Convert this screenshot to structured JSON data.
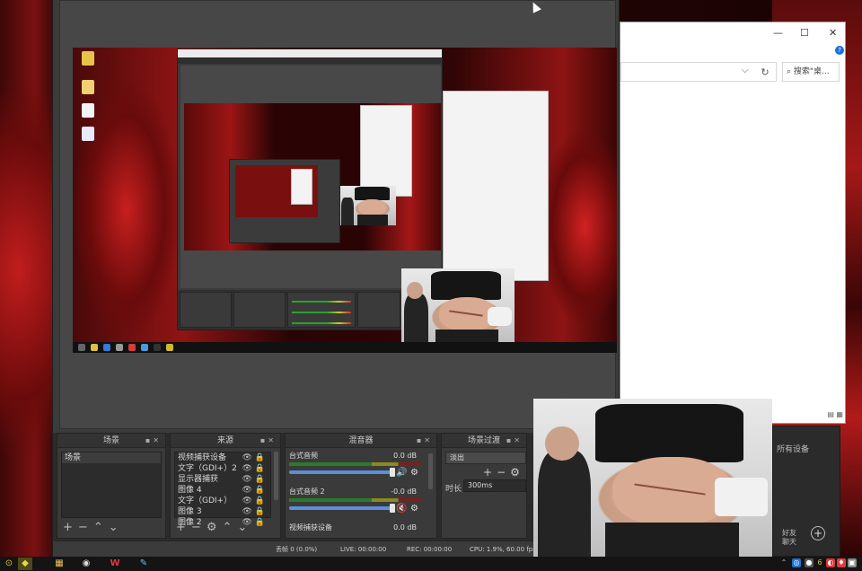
{
  "obs": {
    "docks": {
      "scenes": {
        "title": "场景",
        "items": [
          "场景"
        ]
      },
      "sources": {
        "title": "来源",
        "items": [
          "视频捕获设备",
          "文字（GDI+）2",
          "显示器捕获",
          "图像 4",
          "文字（GDI+）",
          "图像 3",
          "图像 2"
        ]
      },
      "mixer": {
        "title": "混音器",
        "channels": [
          {
            "name": "台式音频",
            "db": "0.0 dB"
          },
          {
            "name": "台式音频 2",
            "db": "-0.0 dB"
          },
          {
            "name": "视频捕获设备",
            "db": "0.0 dB"
          }
        ]
      },
      "transitions": {
        "title": "场景过渡",
        "selected": "淡出",
        "duration_label": "时长",
        "duration": "300ms"
      }
    },
    "status": {
      "dropped": "丢帧 0 (0.0%)",
      "live": "LIVE: 00:00:00",
      "rec": "REC: 00:00:00",
      "cpu": "CPU: 1.9%, 60.00 fps"
    }
  },
  "explorer": {
    "search_placeholder": "搜索\"桌...",
    "help": "?",
    "controls": {
      "minimize": "—",
      "maximize": "☐",
      "close": "✕"
    },
    "refresh": "↻",
    "dropdown": "⌵"
  },
  "panel": {
    "text1": "所有设备",
    "text2": "好友\n聊天"
  },
  "taskbar": {
    "left_glyphs": [
      "⊙",
      "◆",
      "▦",
      "◉",
      "W",
      "✎"
    ],
    "tray_glyphs": [
      "⌃",
      "◎",
      "●",
      "6",
      "◐",
      "♦",
      "▣",
      "◍"
    ]
  },
  "colors": {
    "obs_bg": "#3b3b3b",
    "dock_bg": "#2b2b2b",
    "accent_blue": "#5b8fd6",
    "mute_red": "#e03a3a"
  }
}
